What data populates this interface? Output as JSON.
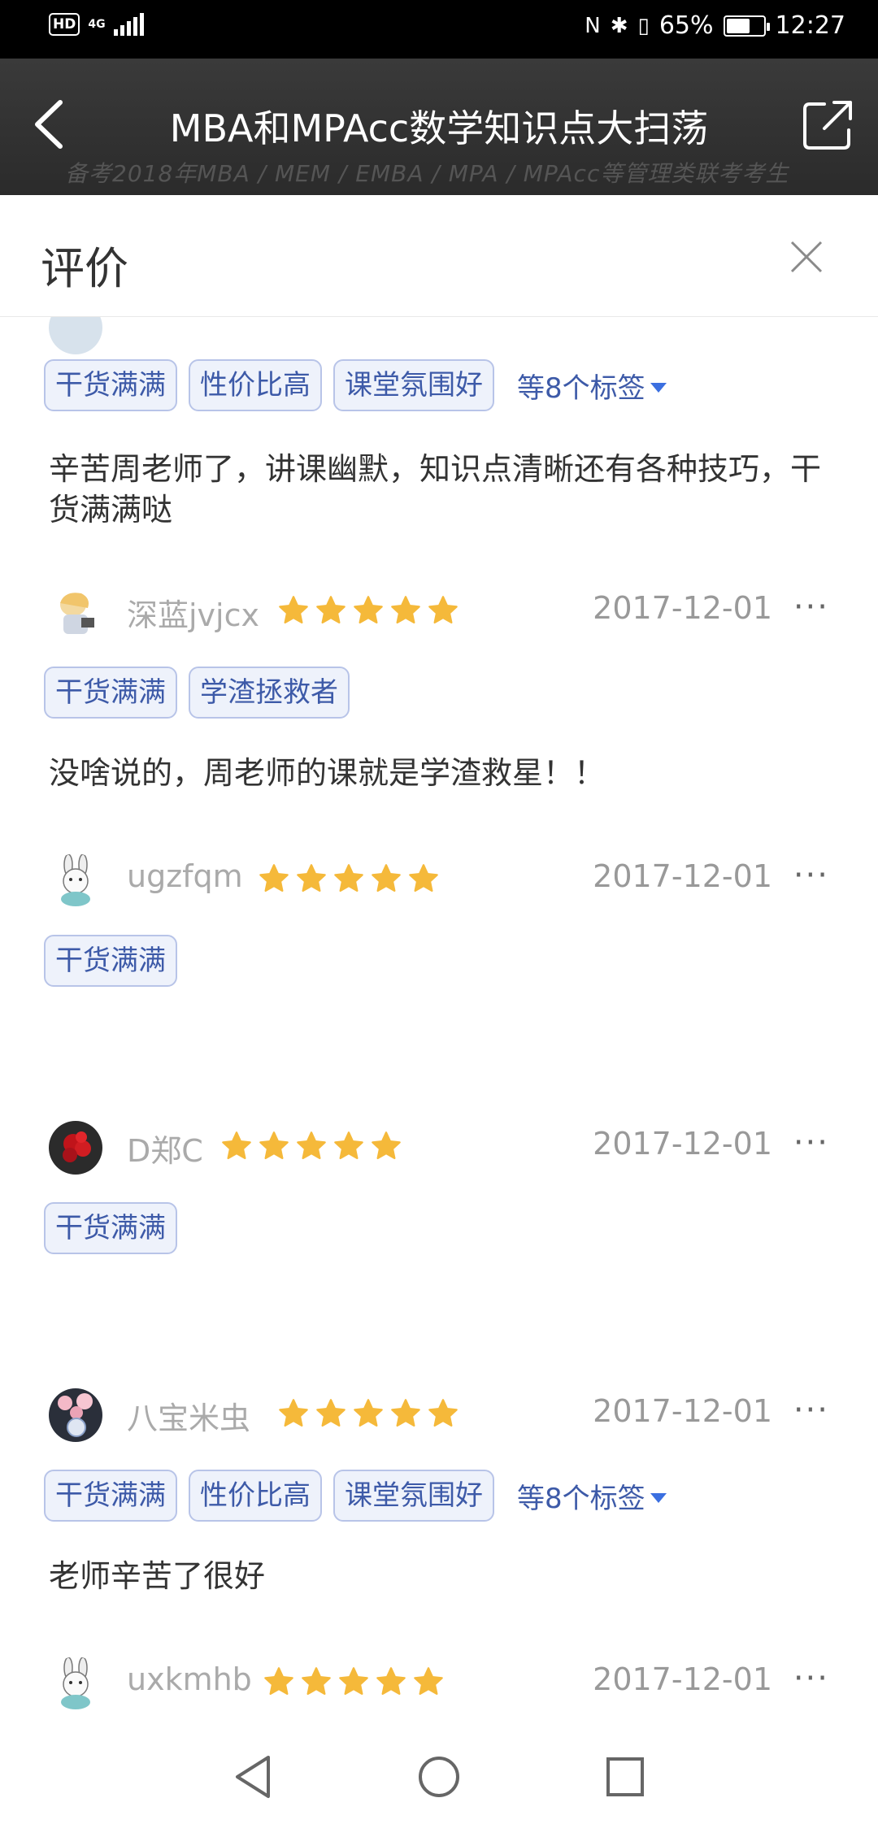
{
  "status_bar": {
    "hd": "HD",
    "network": "4G",
    "battery_percent": "65%",
    "battery_level": 0.65,
    "time": "12:27"
  },
  "header": {
    "title": "MBA和MPAcc数学知识点大扫荡",
    "background_text": "备考2018年MBA / MEM / EMBA / MPA / MPAcc等管理类联考考生"
  },
  "sheet": {
    "title": "评价"
  },
  "reviews": [
    {
      "tags": [
        "干货满满",
        "性价比高",
        "课堂氛围好"
      ],
      "more_tags": "等8个标签",
      "comment": "辛苦周老师了，讲课幽默，知识点清晰还有各种技巧，干货满满哒"
    },
    {
      "username": "深蓝jvjcx",
      "rating": 5,
      "date": "2017-12-01",
      "more": "···",
      "tags": [
        "干货满满",
        "学渣拯救者"
      ],
      "comment": "没啥说的，周老师的课就是学渣救星！！"
    },
    {
      "username": "ugzfqm",
      "rating": 5,
      "date": "2017-12-01",
      "more": "···",
      "tags": [
        "干货满满"
      ]
    },
    {
      "username": "D郑C",
      "rating": 5,
      "date": "2017-12-01",
      "more": "···",
      "tags": [
        "干货满满"
      ]
    },
    {
      "username": "八宝米虫",
      "rating": 5,
      "date": "2017-12-01",
      "more": "···",
      "tags": [
        "干货满满",
        "性价比高",
        "课堂氛围好"
      ],
      "more_tags": "等8个标签",
      "comment": "老师辛苦了很好"
    },
    {
      "username": "uxkmhb",
      "rating": 5,
      "date": "2017-12-01",
      "more": "···"
    }
  ],
  "colors": {
    "star": "#F5B93A",
    "tag_text": "#3D5AA8",
    "tag_border": "#B8C4E8",
    "tag_bg": "#EEF2FB",
    "accent": "#3B6FE0"
  },
  "icons": {
    "back": "back-arrow-icon",
    "share": "share-icon",
    "close": "close-icon",
    "nav_back": "nav-back-icon",
    "nav_home": "nav-home-icon",
    "nav_recent": "nav-recent-icon"
  }
}
